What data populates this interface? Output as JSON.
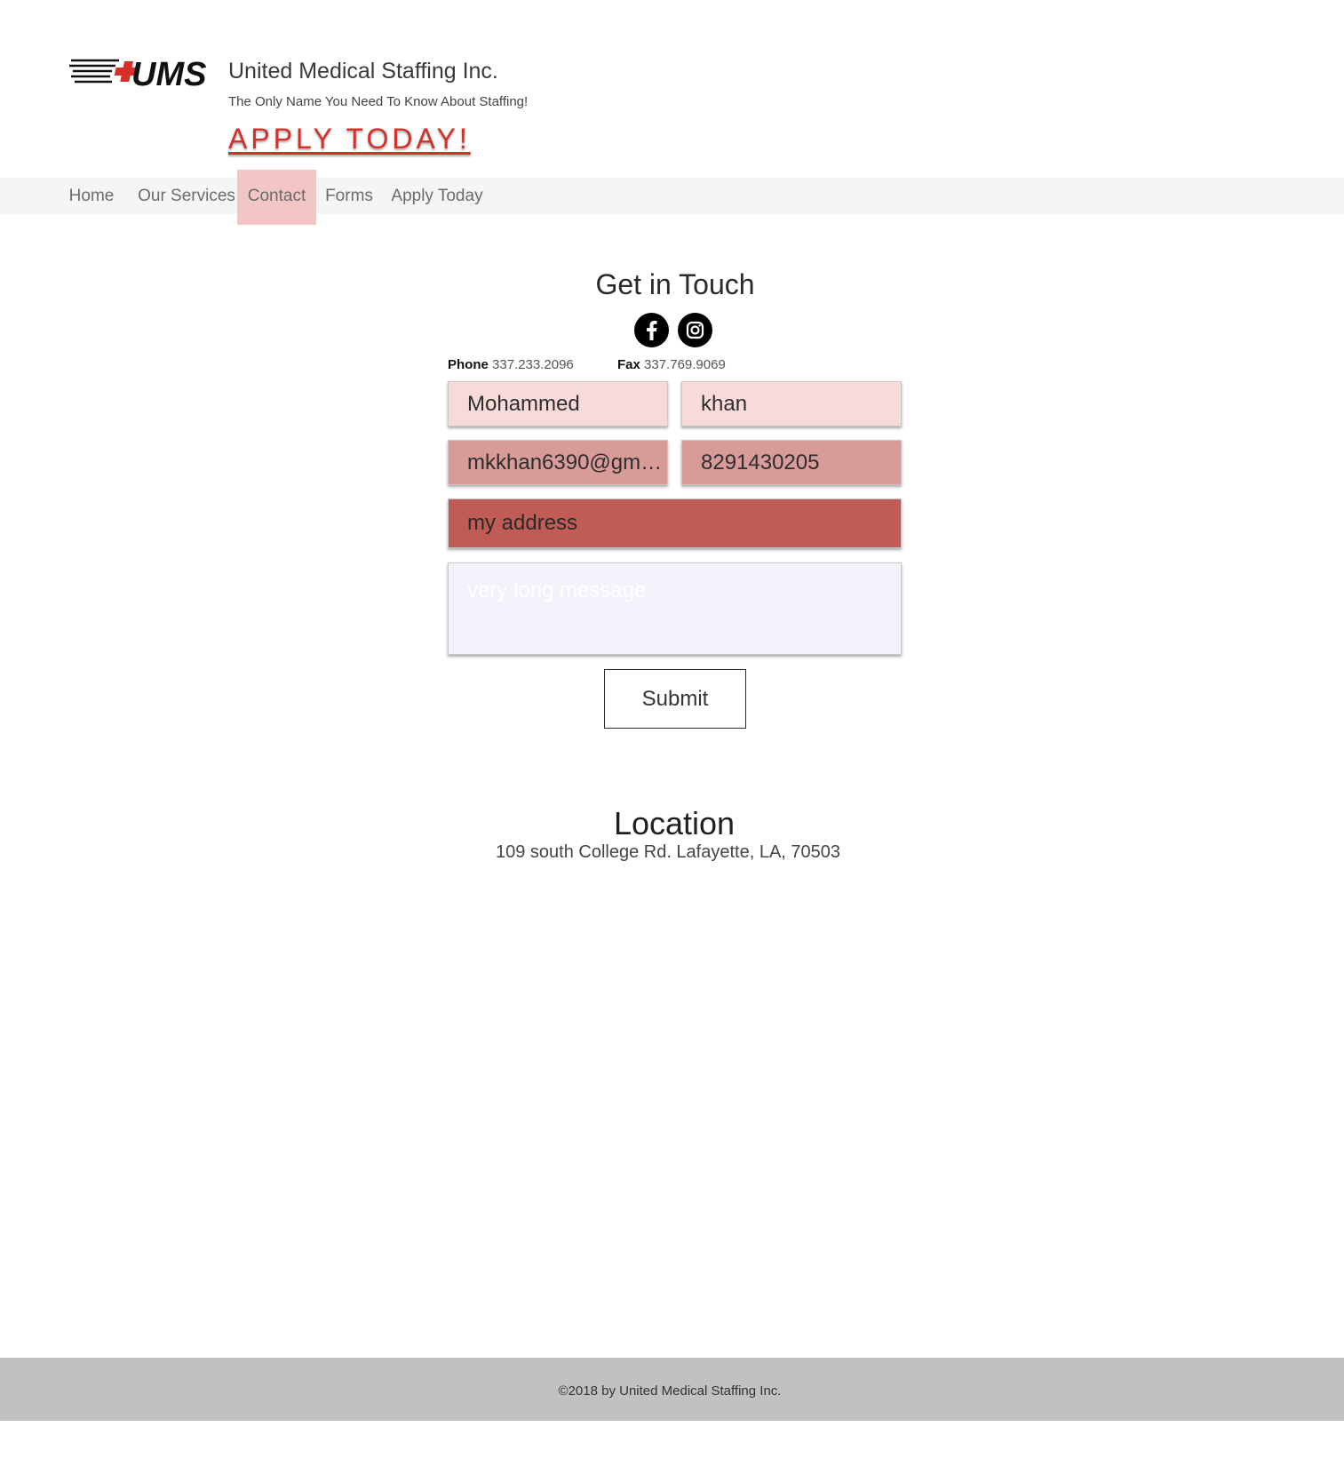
{
  "header": {
    "logo_text": "UMS",
    "site_title": "United Medical Staffing Inc.",
    "tagline": "The Only Name You Need To Know About Staffing!",
    "apply_link": "APPLY TODAY!"
  },
  "nav": {
    "items": [
      {
        "label": "Home"
      },
      {
        "label": "Our Services"
      },
      {
        "label": "Contact",
        "active": true
      },
      {
        "label": "Forms"
      },
      {
        "label": "Apply Today"
      }
    ]
  },
  "contact": {
    "title": "Get in Touch",
    "social": [
      "facebook-icon",
      "instagram-icon"
    ],
    "phone_label": "Phone",
    "phone_value": "337.233.2096",
    "fax_label": "Fax",
    "fax_value": "337.769.9069",
    "form": {
      "first_name": "Mohammed",
      "last_name": "khan",
      "email": "mkkhan6390@gmail.…",
      "phone": "8291430205",
      "address": "my address",
      "message_placeholder": "very long message",
      "submit_label": "Submit"
    }
  },
  "location": {
    "title": "Location",
    "address": "109 south College Rd. Lafayette, LA, 70503"
  },
  "footer": {
    "copyright": "©2018 by United Medical Staffing Inc."
  },
  "colors": {
    "accent_red": "#d62f2a",
    "nav_active": "#f2c6c5",
    "field_light": "#f7dad9",
    "field_mid": "#d99b97",
    "field_dark": "#c15b56",
    "footer_bg": "#c1c1c1"
  }
}
